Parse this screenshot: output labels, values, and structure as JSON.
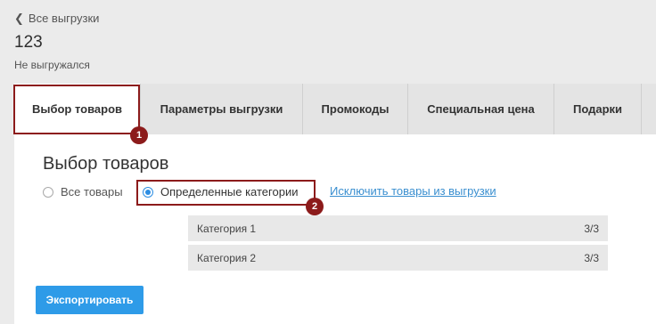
{
  "header": {
    "back_label": "Все выгрузки",
    "title": "123",
    "status": "Не выгружался"
  },
  "tabs": [
    {
      "label": "Выбор товаров",
      "active": true
    },
    {
      "label": "Параметры выгрузки",
      "active": false
    },
    {
      "label": "Промокоды",
      "active": false
    },
    {
      "label": "Специальная цена",
      "active": false
    },
    {
      "label": "Подарки",
      "active": false
    }
  ],
  "section": {
    "title": "Выбор товаров",
    "radio_all": "Все товары",
    "radio_categories": "Определенные категории",
    "selected": "radio_categories",
    "exclude_link": "Исключить товары из выгрузки"
  },
  "categories": [
    {
      "name": "Категория 1",
      "count": "3/3"
    },
    {
      "name": "Категория 2",
      "count": "3/3"
    }
  ],
  "export_button": "Экспортировать",
  "annotations": [
    "1",
    "2"
  ],
  "colors": {
    "accent": "#2e9be8",
    "link": "#3a8fd0",
    "highlight": "#8c1b1b",
    "background": "#ebebeb"
  }
}
